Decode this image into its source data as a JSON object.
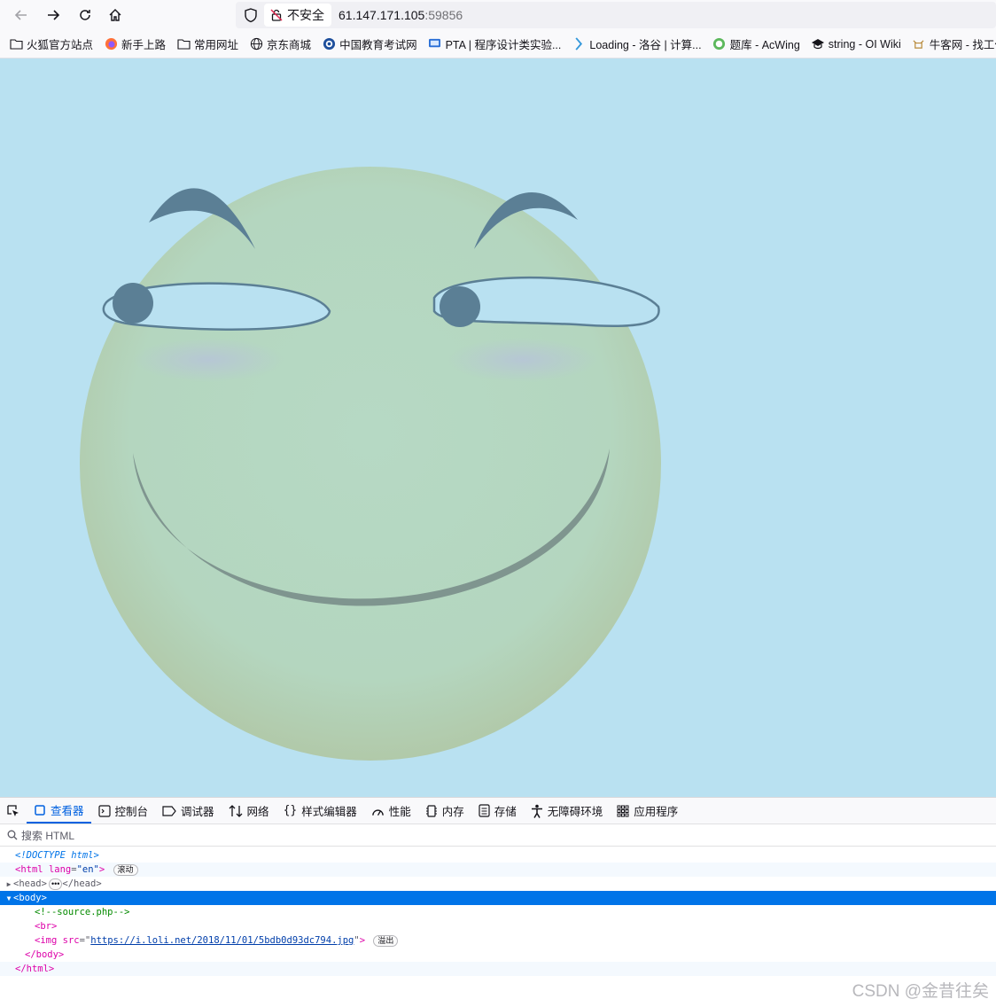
{
  "browser": {
    "insecure_label": "不安全",
    "url_host": "61.147.171.105",
    "url_port": ":59856"
  },
  "bookmarks": [
    {
      "icon": "folder-icon",
      "label": "火狐官方站点"
    },
    {
      "icon": "firefox-icon",
      "label": "新手上路"
    },
    {
      "icon": "folder-icon",
      "label": "常用网址"
    },
    {
      "icon": "globe-icon",
      "label": "京东商城"
    },
    {
      "icon": "chsi-icon",
      "label": "中国教育考试网"
    },
    {
      "icon": "pta-icon",
      "label": "PTA | 程序设计类实验..."
    },
    {
      "icon": "luogu-icon",
      "label": "Loading - 洛谷 | 计算..."
    },
    {
      "icon": "acwing-icon",
      "label": "题库 - AcWing"
    },
    {
      "icon": "oiwiki-icon",
      "label": "string - OI Wiki"
    },
    {
      "icon": "nowcoder-icon",
      "label": "牛客网 - 找工作"
    }
  ],
  "devtools": {
    "tabs": [
      {
        "icon": "inspector-icon",
        "label": "查看器"
      },
      {
        "icon": "console-icon",
        "label": "控制台"
      },
      {
        "icon": "debugger-icon",
        "label": "调试器"
      },
      {
        "icon": "network-icon",
        "label": "网络"
      },
      {
        "icon": "style-editor-icon",
        "label": "样式编辑器"
      },
      {
        "icon": "performance-icon",
        "label": "性能"
      },
      {
        "icon": "memory-icon",
        "label": "内存"
      },
      {
        "icon": "storage-icon",
        "label": "存储"
      },
      {
        "icon": "accessibility-icon",
        "label": "无障碍环境"
      },
      {
        "icon": "application-icon",
        "label": "应用程序"
      }
    ],
    "search_placeholder": "搜索 HTML",
    "markup": {
      "doctype": "<!DOCTYPE html>",
      "html_open": "<html",
      "lang_attr": "lang",
      "lang_val": "\"en\"",
      "html_close_bracket": ">",
      "scroll_badge": "滚动",
      "head_open": "<head>",
      "head_ellipsis": "•••",
      "head_close": "</head>",
      "body_open": "<body>",
      "comment": "<!--source.php-->",
      "br": "<br>",
      "img_open": "<img",
      "src_attr": "src",
      "src_val": "https://i.loli.net/2018/11/01/5bdb0d93dc794.jpg",
      "overflow_badge": "溢出",
      "body_close": "</body>",
      "html_close": "</html>"
    }
  },
  "watermark": "CSDN @金昔往矣",
  "colors": {
    "page_background": "#b9e1f1",
    "face": "#b5d6c0",
    "eyebrow": "#5b7f95",
    "selection": "#0074e8"
  }
}
